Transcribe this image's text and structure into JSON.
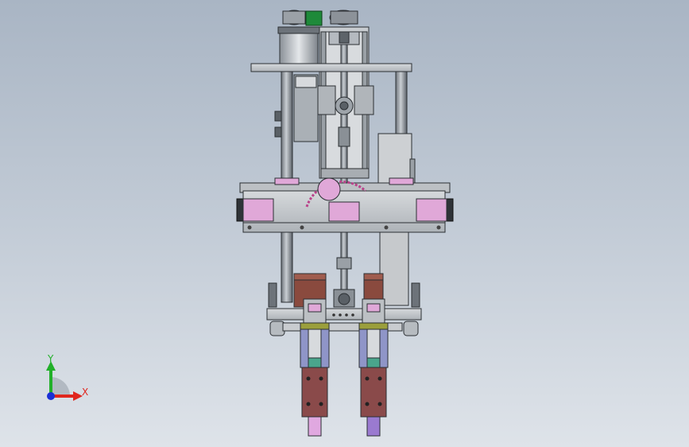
{
  "triad": {
    "y_label": "Y",
    "x_label": "X",
    "colors": {
      "x": "#e0261e",
      "y": "#22b02a",
      "z": "#1a2fd6"
    }
  },
  "view": {
    "background_top": "#a9b5c4",
    "background_bottom": "#dee3e9",
    "accent_pink": "#e0a8d8",
    "accent_brown": "#8a4a3e",
    "accent_green": "#1e8a3a"
  }
}
